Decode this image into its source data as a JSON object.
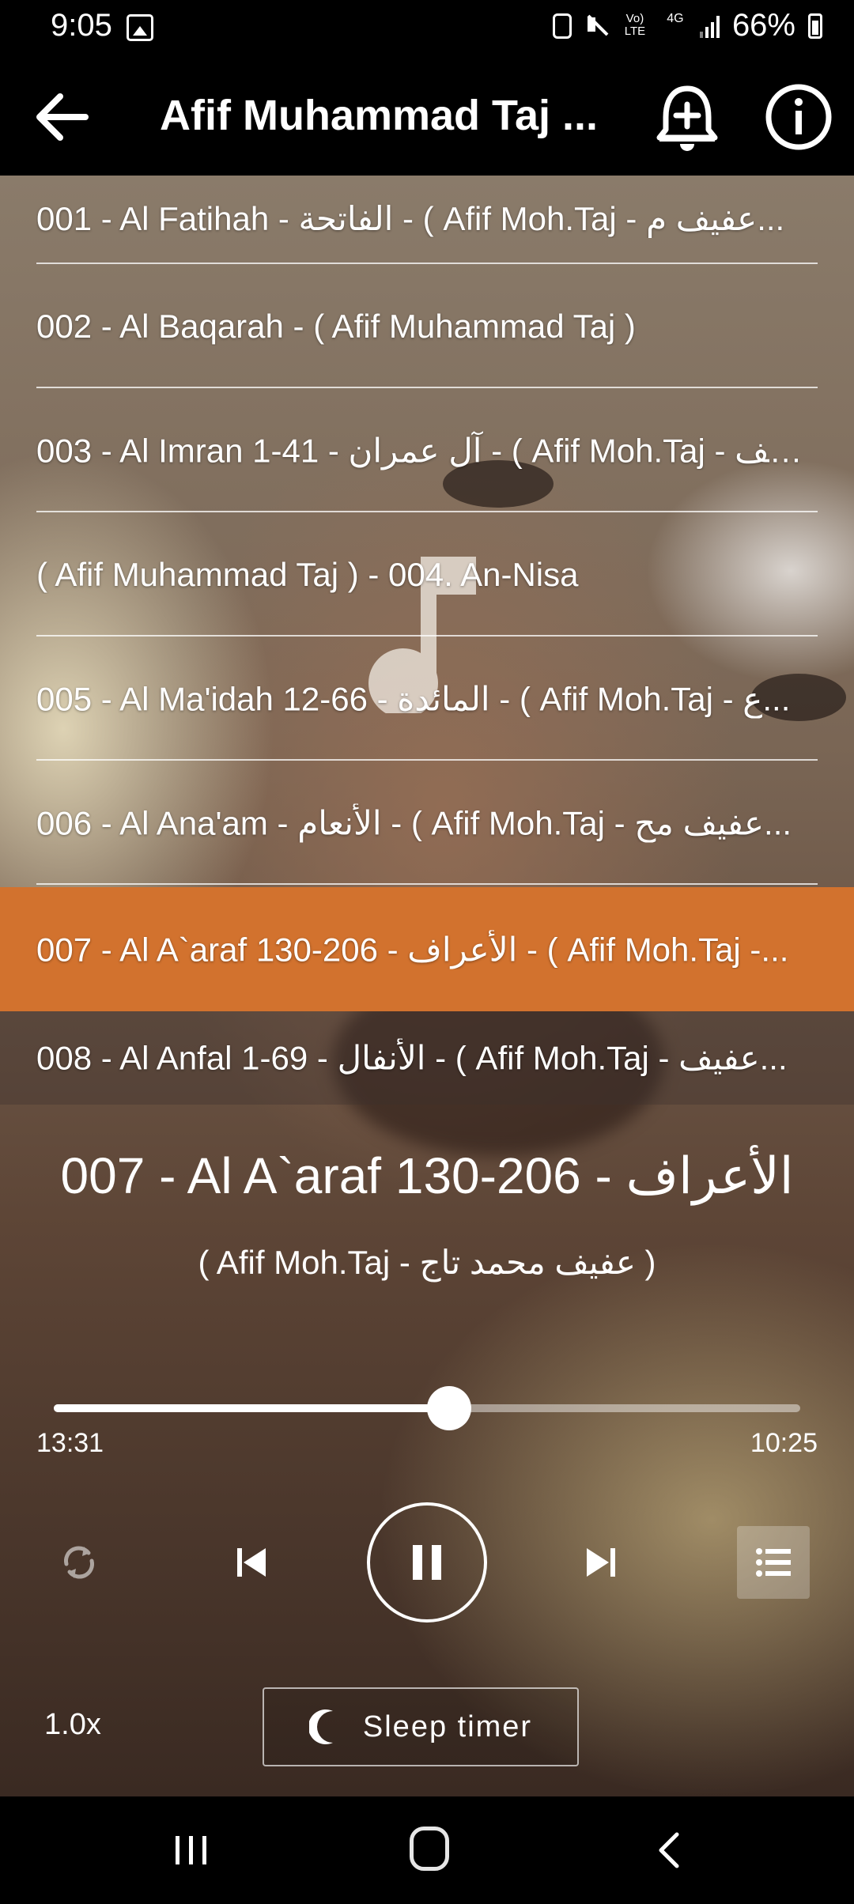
{
  "status_bar": {
    "time": "9:05",
    "battery_percent": "66%",
    "network_lte": "Vo) LTE",
    "network_4g": "4G",
    "icons": [
      "gallery-icon",
      "sync-icon",
      "mute-icon",
      "volte-icon",
      "4g-icon",
      "signal-icon",
      "battery-icon"
    ]
  },
  "app_bar": {
    "title": "Afif Muhammad Taj ...",
    "back_icon": "arrow-left-icon",
    "bell_icon": "bell-plus-icon",
    "info_icon": "info-circle-icon"
  },
  "tracks": [
    {
      "label": "001 - Al Fatihah - الفاتحة - ( Afif Moh.Taj - عفيف م...",
      "active": false
    },
    {
      "label": "002 - Al Baqarah - ( Afif Muhammad Taj )",
      "active": false
    },
    {
      "label": "003 - Al Imran 1-41 - آل عمران - ( Afif Moh.Taj - عف...",
      "active": false
    },
    {
      "label": "( Afif Muhammad Taj ) - 004. An-Nisa",
      "active": false
    },
    {
      "label": "005 - Al Ma'idah 12-66 - المائدة - ( Afif Moh.Taj - ع...",
      "active": false
    },
    {
      "label": "006 -  Al Ana'am - الأنعام - ( Afif Moh.Taj - عفيف مح...",
      "active": false
    },
    {
      "label": "007 - Al A`araf 130-206 - الأعراف - ( Afif Moh.Taj -...",
      "active": true
    },
    {
      "label": "008 - Al Anfal 1-69 - الأنفال - ( Afif Moh.Taj -  عفيف...",
      "active": false
    }
  ],
  "now_playing": {
    "title": "007 - Al A`araf 130-206 - الأعراف",
    "artist": "( Afif Moh.Taj - عفيف محمد تاج )",
    "elapsed": "13:31",
    "total": "10:25",
    "progress_fraction": 0.53
  },
  "controls": {
    "repeat_icon": "repeat-icon",
    "prev_icon": "skip-previous-icon",
    "play_icon": "pause-icon",
    "next_icon": "skip-next-icon",
    "queue_icon": "queue-list-icon",
    "speed": "1.0x",
    "sleep_timer_label": "Sleep timer",
    "sleep_icon": "moon-icon"
  },
  "nav_bar": {
    "recents_icon": "recents-icon",
    "home_icon": "home-icon",
    "back_icon": "nav-back-icon"
  },
  "colors": {
    "accent": "#d2722e",
    "bar_background": "#000000"
  }
}
